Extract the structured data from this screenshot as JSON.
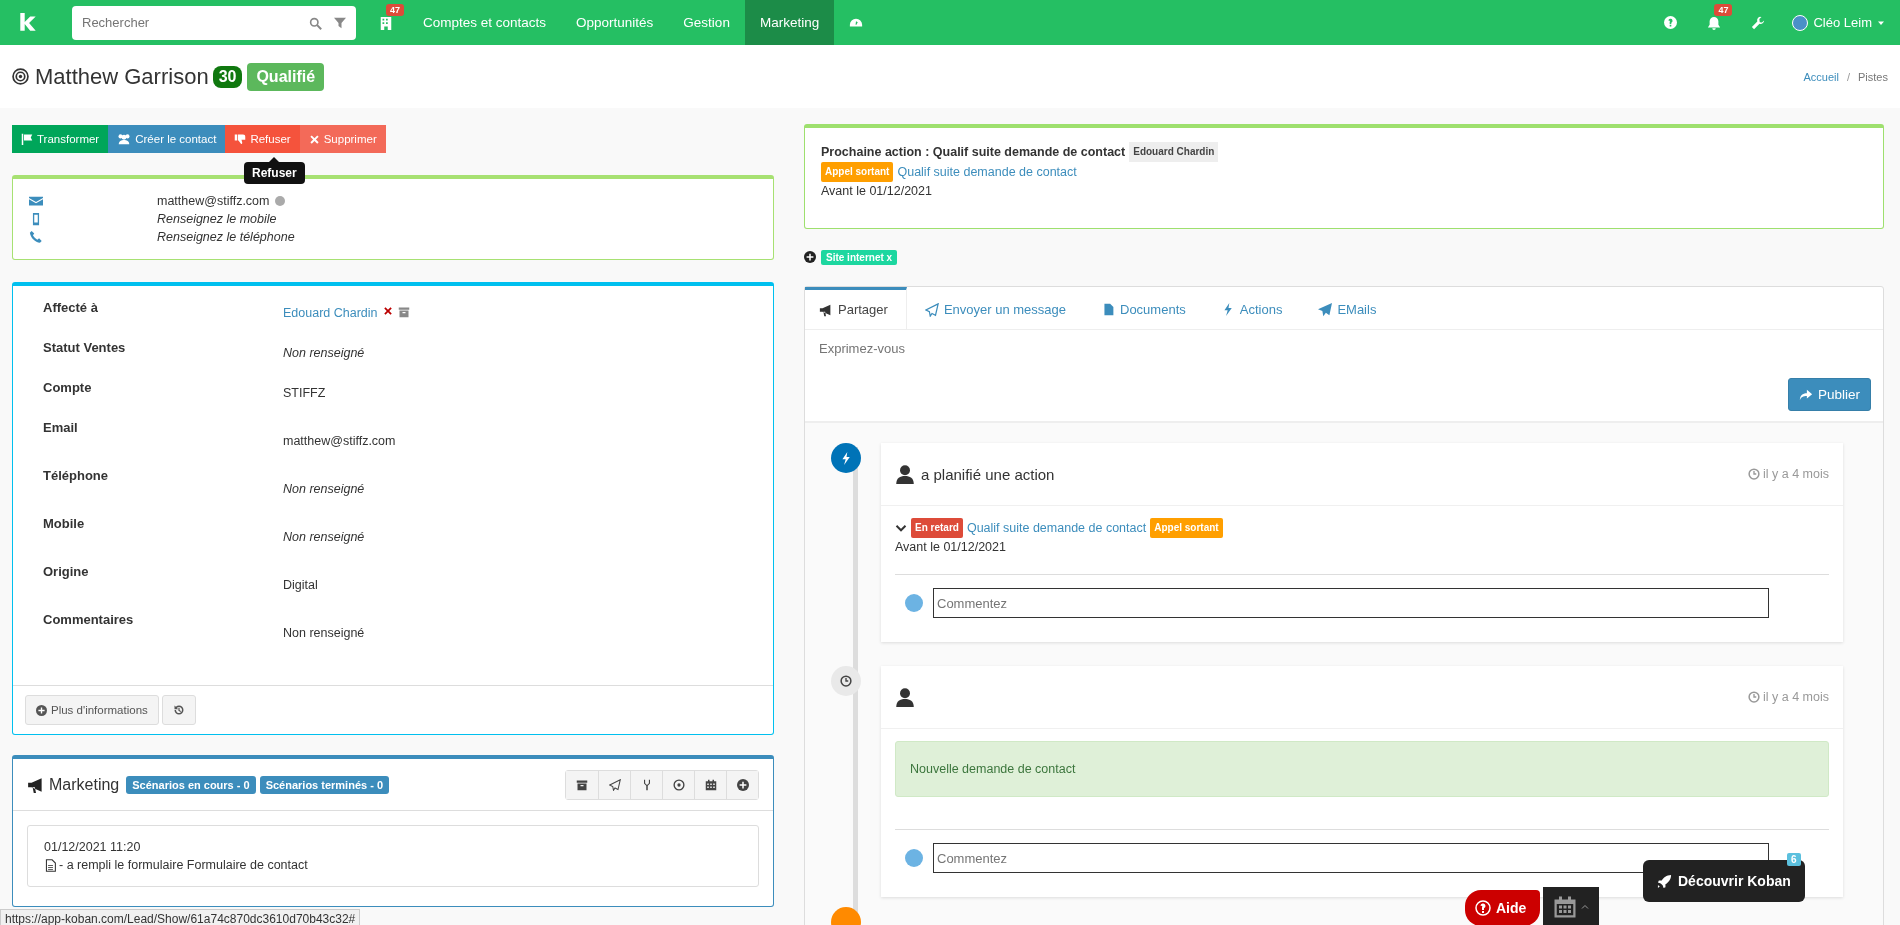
{
  "nav": {
    "search_placeholder": "Rechercher",
    "calendar_badge": "47",
    "items": [
      {
        "label": "Comptes et contacts",
        "selected": false
      },
      {
        "label": "Opportunités",
        "selected": false
      },
      {
        "label": "Gestion",
        "selected": false
      },
      {
        "label": "Marketing",
        "selected": true
      }
    ],
    "notifications_badge": "47",
    "user": "Cléo Leim"
  },
  "header": {
    "title": "Matthew Garrison",
    "score": "30",
    "status": "Qualifié",
    "breadcrumb": [
      "Accueil",
      "Pistes"
    ],
    "breadcrumb_separator": "/"
  },
  "actions": [
    {
      "kind": "transform",
      "label": "Transformer"
    },
    {
      "kind": "contact",
      "label": "Créer le contact"
    },
    {
      "kind": "refuse",
      "label": "Refuser"
    },
    {
      "kind": "delete",
      "label": "Supprimer"
    }
  ],
  "tooltip": "Refuser",
  "contact_rows": [
    {
      "kind": "email",
      "value": "matthew@stiffz.com"
    },
    {
      "kind": "mobile",
      "placeholder": "Renseignez le mobile"
    },
    {
      "kind": "phone",
      "placeholder": "Renseignez le téléphone"
    }
  ],
  "details": {
    "fields": [
      {
        "label": "Affecté à",
        "value": "Edouard Chardin",
        "kind": "user"
      },
      {
        "label": "Statut Ventes",
        "value": "Non renseigné",
        "kind": "empty"
      },
      {
        "label": "Compte",
        "value": "STIFFZ",
        "kind": "text"
      },
      {
        "label": "Email",
        "value": "matthew@stiffz.com",
        "kind": "text"
      },
      {
        "label": "Téléphone",
        "value": "Non renseigné",
        "kind": "empty"
      },
      {
        "label": "Mobile",
        "value": "Non renseigné",
        "kind": "empty"
      },
      {
        "label": "Origine",
        "value": "Digital",
        "kind": "text"
      },
      {
        "label": "Commentaires",
        "value": "Non renseigné",
        "kind": "text"
      }
    ],
    "more_button": "Plus d'informations"
  },
  "marketing": {
    "title": "Marketing",
    "badges": [
      "Scénarios en cours - 0",
      "Scénarios terminés - 0"
    ],
    "events": [
      {
        "date": "01/12/2021 11:20",
        "text": "- a rempli le formulaire Formulaire de contact"
      }
    ]
  },
  "status_url": "https://app-koban.com/Lead/Show/61a74c870dc3610d70b43c32#",
  "next_action": {
    "title": "Prochaine action : Qualif suite demande de contact",
    "assignee": "Edouard Chardin",
    "type_badge": "Appel sortant",
    "link": "Qualif suite demande de contact",
    "due": "Avant le 01/12/2021"
  },
  "tags": [
    "Site internet x"
  ],
  "tabs": [
    {
      "label": "Partager",
      "kind": "share",
      "selected": true
    },
    {
      "label": "Envoyer un message",
      "kind": "message",
      "selected": false
    },
    {
      "label": "Documents",
      "kind": "documents",
      "selected": false
    },
    {
      "label": "Actions",
      "kind": "actions",
      "selected": false
    },
    {
      "label": "EMails",
      "kind": "emails",
      "selected": false
    }
  ],
  "composer": {
    "placeholder": "Exprimez-vous",
    "button": "Publier"
  },
  "timeline": [
    {
      "kind": "action",
      "title": "a planifié une action",
      "time": "il y a 4 mois",
      "status_badge": "En retard",
      "link": "Qualif suite demande de contact",
      "type_badge": "Appel sortant",
      "due": "Avant le 01/12/2021",
      "comment_placeholder": "Commentez"
    },
    {
      "kind": "note",
      "time": "il y a 4 mois",
      "message": "Nouvelle demande de contact",
      "comment_placeholder": "Commentez"
    }
  ],
  "floating": {
    "help": "Aide",
    "discover": "Découvrir Koban",
    "discover_badge": "6"
  }
}
